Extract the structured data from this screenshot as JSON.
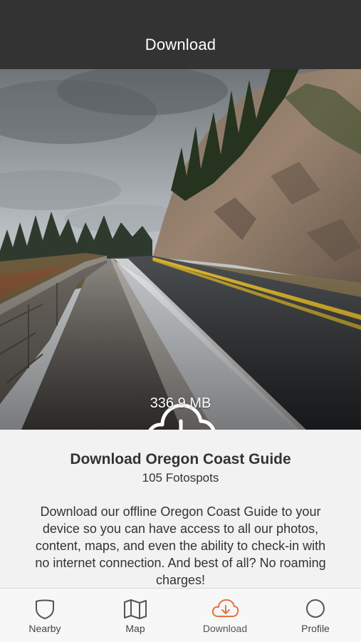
{
  "header": {
    "title": "Download"
  },
  "hero": {
    "download_size": "336.9 MB"
  },
  "guide": {
    "title": "Download Oregon Coast Guide",
    "spots": "105 Fotospots",
    "description": "Download our offline Oregon Coast Guide to your device so you can have access to all our photos, content, maps, and even the ability to check-in with no internet connection. And best of all? No roaming charges!"
  },
  "tabs": [
    {
      "label": "Nearby",
      "icon": "shield-icon",
      "active": false
    },
    {
      "label": "Map",
      "icon": "map-icon",
      "active": false
    },
    {
      "label": "Download",
      "icon": "cloud-download-icon",
      "active": true
    },
    {
      "label": "Profile",
      "icon": "profile-icon",
      "active": false
    }
  ],
  "colors": {
    "header_bg": "#333333",
    "accent": "#e8703a",
    "tab_bg": "#f7f7f7"
  }
}
